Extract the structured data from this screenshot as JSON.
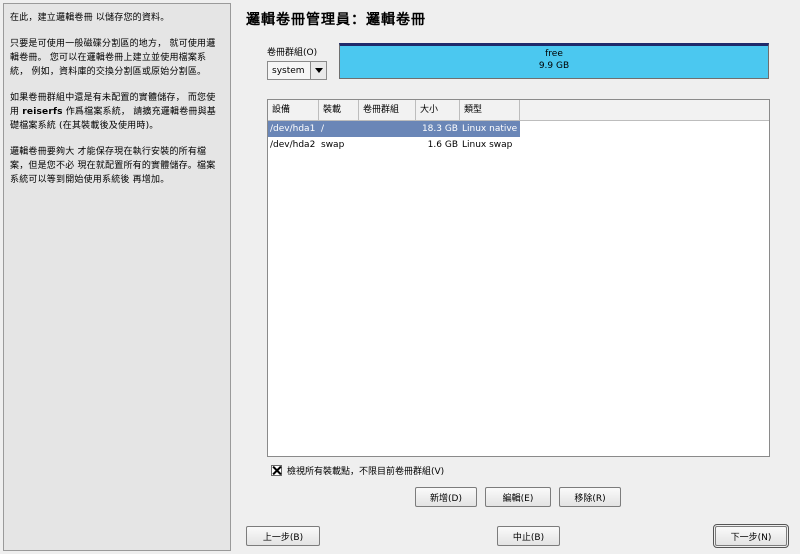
{
  "help": {
    "paragraphs": [
      "在此，建立邏輯卷冊 以儲存您的資料。",
      "只要是可使用一般磁碟分割區的地方， 就可使用邏輯卷冊。 您可以在邏輯卷冊上建立並使用檔案系統， 例如，資料庫的交換分割區或原始分割區。",
      [
        "如果卷冊群組中還是有未配置的實體儲存， 而您使用 ",
        "reiserfs",
        " 作爲檔案系統， 請擴充邏輯卷冊與基礎檔案系統 (在其裝載後及使用時)。"
      ],
      "邏輯卷冊要夠大 才能保存現在執行安裝的所有檔案，但是您不必 現在就配置所有的實體儲存。檔案系統可以等到開始使用系統後 再增加。"
    ]
  },
  "title": "邏輯卷冊管理員：邏輯卷冊",
  "volume_group": {
    "label": "卷冊群組(O)",
    "selected": "system"
  },
  "usage_bar": {
    "label": "free",
    "size": "9.9 GB",
    "color": "#4bc8f0"
  },
  "table": {
    "headers": [
      "設備",
      "裝載",
      "卷冊群組",
      "大小",
      "類型"
    ],
    "rows": [
      {
        "device": "/dev/hda1",
        "mount": "/",
        "vg": "",
        "size": "18.3 GB",
        "type": "Linux native",
        "selected": true
      },
      {
        "device": "/dev/hda2",
        "mount": "swap",
        "vg": "",
        "size": "1.6 GB",
        "type": "Linux swap",
        "selected": false
      }
    ]
  },
  "checkbox": {
    "label": "檢視所有裝載點，不限目前卷冊群組(V)",
    "checked": true
  },
  "buttons": {
    "add": "新增(D)",
    "edit": "編輯(E)",
    "remove": "移除(R)",
    "back": "上一步(B)",
    "abort": "中止(B)",
    "next": "下一步(N)"
  },
  "colors": {
    "selection": "#6a86b7",
    "bar_border_top": "#1f2a6b"
  }
}
